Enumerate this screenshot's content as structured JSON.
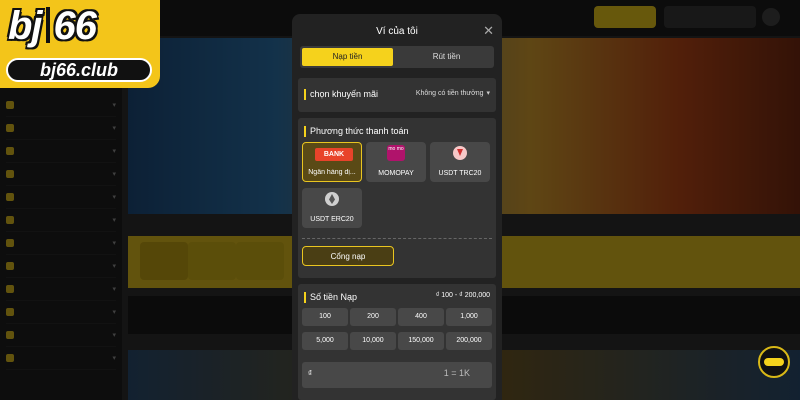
{
  "logo": {
    "brand_left": "bj",
    "brand_right": "66",
    "domain": "bj66.club"
  },
  "modal": {
    "title": "Ví của tôi",
    "close_icon": "close-icon",
    "tabs": [
      {
        "label": "Nạp tiền",
        "active": true
      },
      {
        "label": "Rút tiền",
        "active": false
      }
    ],
    "promo": {
      "label": "chọn khuyến mãi",
      "selected": "Không có tiền thưởng",
      "chevron_icon": "chevron-down-icon"
    },
    "payment": {
      "label": "Phương thức thanh toán",
      "methods": [
        {
          "label": "Ngân hàng dị...",
          "icon": "bank-icon",
          "icon_text": "BANK",
          "selected": true
        },
        {
          "label": "MOMOPAY",
          "icon": "momo-icon",
          "icon_text": "mo mo",
          "selected": false
        },
        {
          "label": "USDT TRC20",
          "icon": "tron-icon",
          "selected": false
        },
        {
          "label": "USDT ERC20",
          "icon": "ethereum-icon",
          "selected": false
        }
      ],
      "gateway_button": "Cổng nạp"
    },
    "amount": {
      "label": "Số tiền Nạp",
      "range": "₫ 100 - ₫ 200,000",
      "presets": [
        "100",
        "200",
        "400",
        "1,000",
        "5,000",
        "10,000",
        "150,000",
        "200,000"
      ],
      "currency_symbol": "₫",
      "rate": "1 = 1K"
    }
  },
  "colors": {
    "accent": "#f5d21c",
    "panel": "#333333",
    "modal_bg": "#222222",
    "selected_border": "#e9c520"
  }
}
